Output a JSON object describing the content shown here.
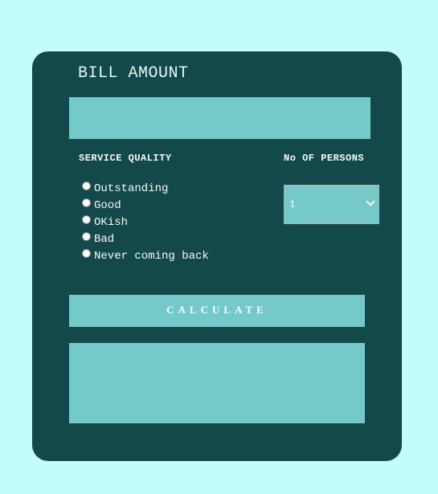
{
  "form": {
    "title": "BILL AMOUNT",
    "bill_value": "",
    "service_label": "SERVICE QUALITY",
    "service_options": [
      "Outstanding",
      "Good",
      "OKish",
      "Bad",
      "Never coming back"
    ],
    "persons_label": "No OF PERSONS",
    "persons_selected": "1",
    "calculate_label": "CALCULATE",
    "result_text": ""
  },
  "colors": {
    "page_background": "#c2fcfc",
    "card_background": "#13494b",
    "field_fill": "#75c9c8",
    "text": "#ffffff"
  },
  "icons": {
    "select_caret": "chevron-down-icon"
  }
}
